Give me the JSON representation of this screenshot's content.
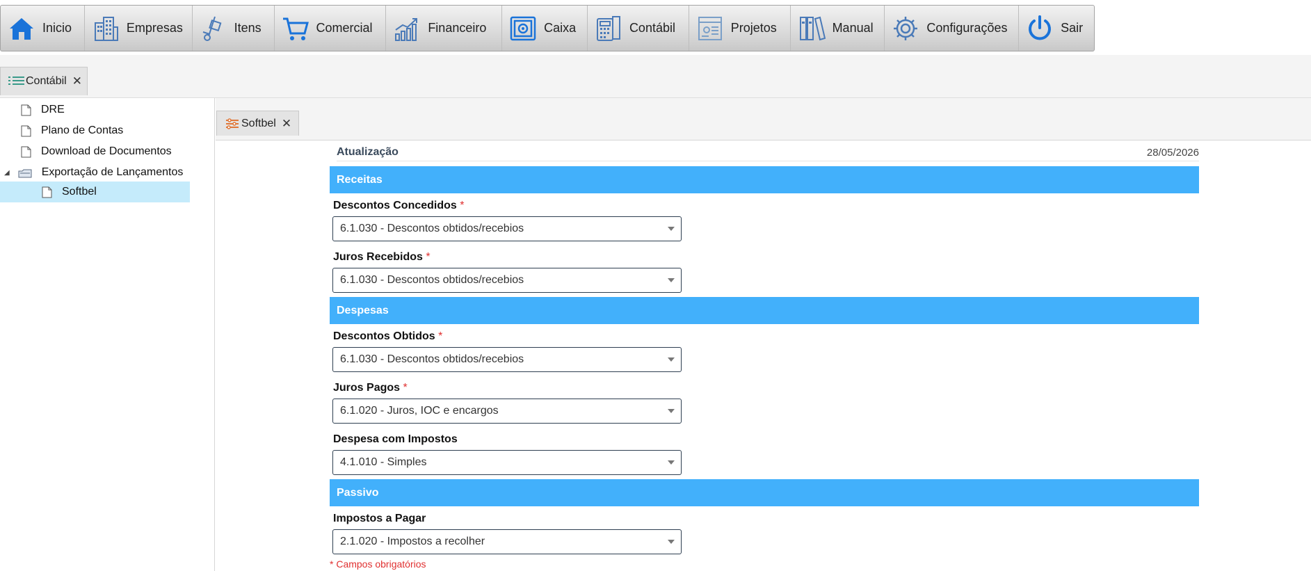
{
  "menu": [
    {
      "label": "Inicio",
      "icon": "home-icon"
    },
    {
      "label": "Empresas",
      "icon": "buildings-icon"
    },
    {
      "label": "Itens",
      "icon": "hand-truck-icon"
    },
    {
      "label": "Comercial",
      "icon": "shopping-cart-icon"
    },
    {
      "label": "Financeiro",
      "icon": "growth-chart-icon"
    },
    {
      "label": "Caixa",
      "icon": "safe-icon"
    },
    {
      "label": "Contábil",
      "icon": "calculator-icon"
    },
    {
      "label": "Projetos",
      "icon": "blueprint-icon"
    },
    {
      "label": "Manual",
      "icon": "binders-icon"
    },
    {
      "label": "Configurações",
      "icon": "gear-icon"
    },
    {
      "label": "Sair",
      "icon": "power-icon"
    }
  ],
  "outer_tab": {
    "label": "Contábil",
    "close": "✕",
    "icon": "list-icon"
  },
  "inner_tab": {
    "label": "Softbel",
    "close": "✕",
    "icon": "sliders-icon"
  },
  "tree": [
    {
      "label": "DRE",
      "icon": "document-icon"
    },
    {
      "label": "Plano de Contas",
      "icon": "document-icon"
    },
    {
      "label": "Download de Documentos",
      "icon": "document-icon"
    },
    {
      "label": "Exportação de Lançamentos",
      "icon": "folder-icon",
      "expander": "◢"
    },
    {
      "label": "Softbel",
      "icon": "document-icon",
      "selected": true
    }
  ],
  "form": {
    "update_label": "Atualização",
    "update_date": "28/05/2026",
    "sections": {
      "receitas": "Receitas",
      "despesas": "Despesas",
      "passivo": "Passivo"
    },
    "required_mark": "*",
    "fields": {
      "descontos_concedidos": {
        "label": "Descontos Concedidos",
        "value": "6.1.030 - Descontos obtidos/recebios"
      },
      "juros_recebidos": {
        "label": "Juros Recebidos",
        "value": "6.1.030 - Descontos obtidos/recebios"
      },
      "descontos_obtidos": {
        "label": "Descontos Obtidos",
        "value": "6.1.030 - Descontos obtidos/recebios"
      },
      "juros_pagos": {
        "label": "Juros Pagos",
        "value": "6.1.020 - Juros, IOC e encargos"
      },
      "despesa_impostos": {
        "label": "Despesa com Impostos",
        "value": "4.1.010 - Simples"
      },
      "impostos_pagar": {
        "label": "Impostos a Pagar",
        "value": "2.1.020 - Impostos a recolher"
      }
    },
    "required_note": "* Campos obrigatórios"
  },
  "colors": {
    "section_bg": "#42b0fb",
    "selected_tree": "#c5ebfb",
    "required": "#e03030",
    "icon_blue": "#1a73d9"
  }
}
